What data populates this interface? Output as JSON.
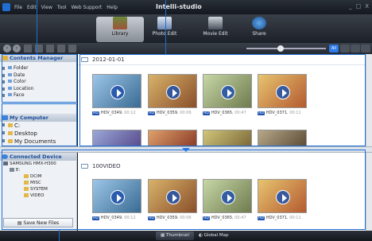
{
  "app": {
    "title": "Intelli-studio",
    "menu": [
      "File",
      "Edit",
      "View",
      "Tool",
      "Web Support",
      "Help"
    ],
    "window_controls": [
      "_",
      "□",
      "X"
    ]
  },
  "modes": [
    {
      "label": "Library",
      "active": true
    },
    {
      "label": "Photo Edit",
      "active": false
    },
    {
      "label": "Movie Edit",
      "active": false
    },
    {
      "label": "Share",
      "active": false
    }
  ],
  "toolbar": {
    "all_label": "All",
    "zoom_fraction": 0.42
  },
  "contents_manager": {
    "title": "Contents Manager",
    "items": [
      "Folder",
      "Date",
      "Color",
      "Location",
      "Face"
    ]
  },
  "my_computer": {
    "title": "My Computer",
    "items": [
      "C:",
      "Desktop",
      "My Documents"
    ]
  },
  "library": {
    "date_header": "2012-01-01",
    "row1": [
      {
        "name": "HDV_0349.",
        "duration": "00:12"
      },
      {
        "name": "HDV_0359.",
        "duration": "00:06"
      },
      {
        "name": "HDV_0365.",
        "duration": "00:47"
      },
      {
        "name": "HDV_0371.",
        "duration": "00:11"
      }
    ]
  },
  "connected_device": {
    "title": "Connected Device",
    "device": "SAMSUNG HMX-H300",
    "drive": "E:",
    "folders": [
      "DCIM",
      "MISC",
      "SYSTEM",
      "VIDEO"
    ],
    "save_label": "Save New Files"
  },
  "device_content": {
    "folder_header": "100VIDEO",
    "row": [
      {
        "name": "HDV_0349.",
        "duration": "00:12"
      },
      {
        "name": "HDV_0359.",
        "duration": "00:06"
      },
      {
        "name": "HDV_0365.",
        "duration": "00:47"
      },
      {
        "name": "HDV_0371.",
        "duration": "00:11"
      }
    ]
  },
  "bottom_tabs": [
    {
      "label": "Thumbnail",
      "active": true
    },
    {
      "label": "Global Map",
      "active": false
    }
  ],
  "colors": {
    "accent": "#1d6fd6",
    "selected_tab": "#2c7be8"
  }
}
